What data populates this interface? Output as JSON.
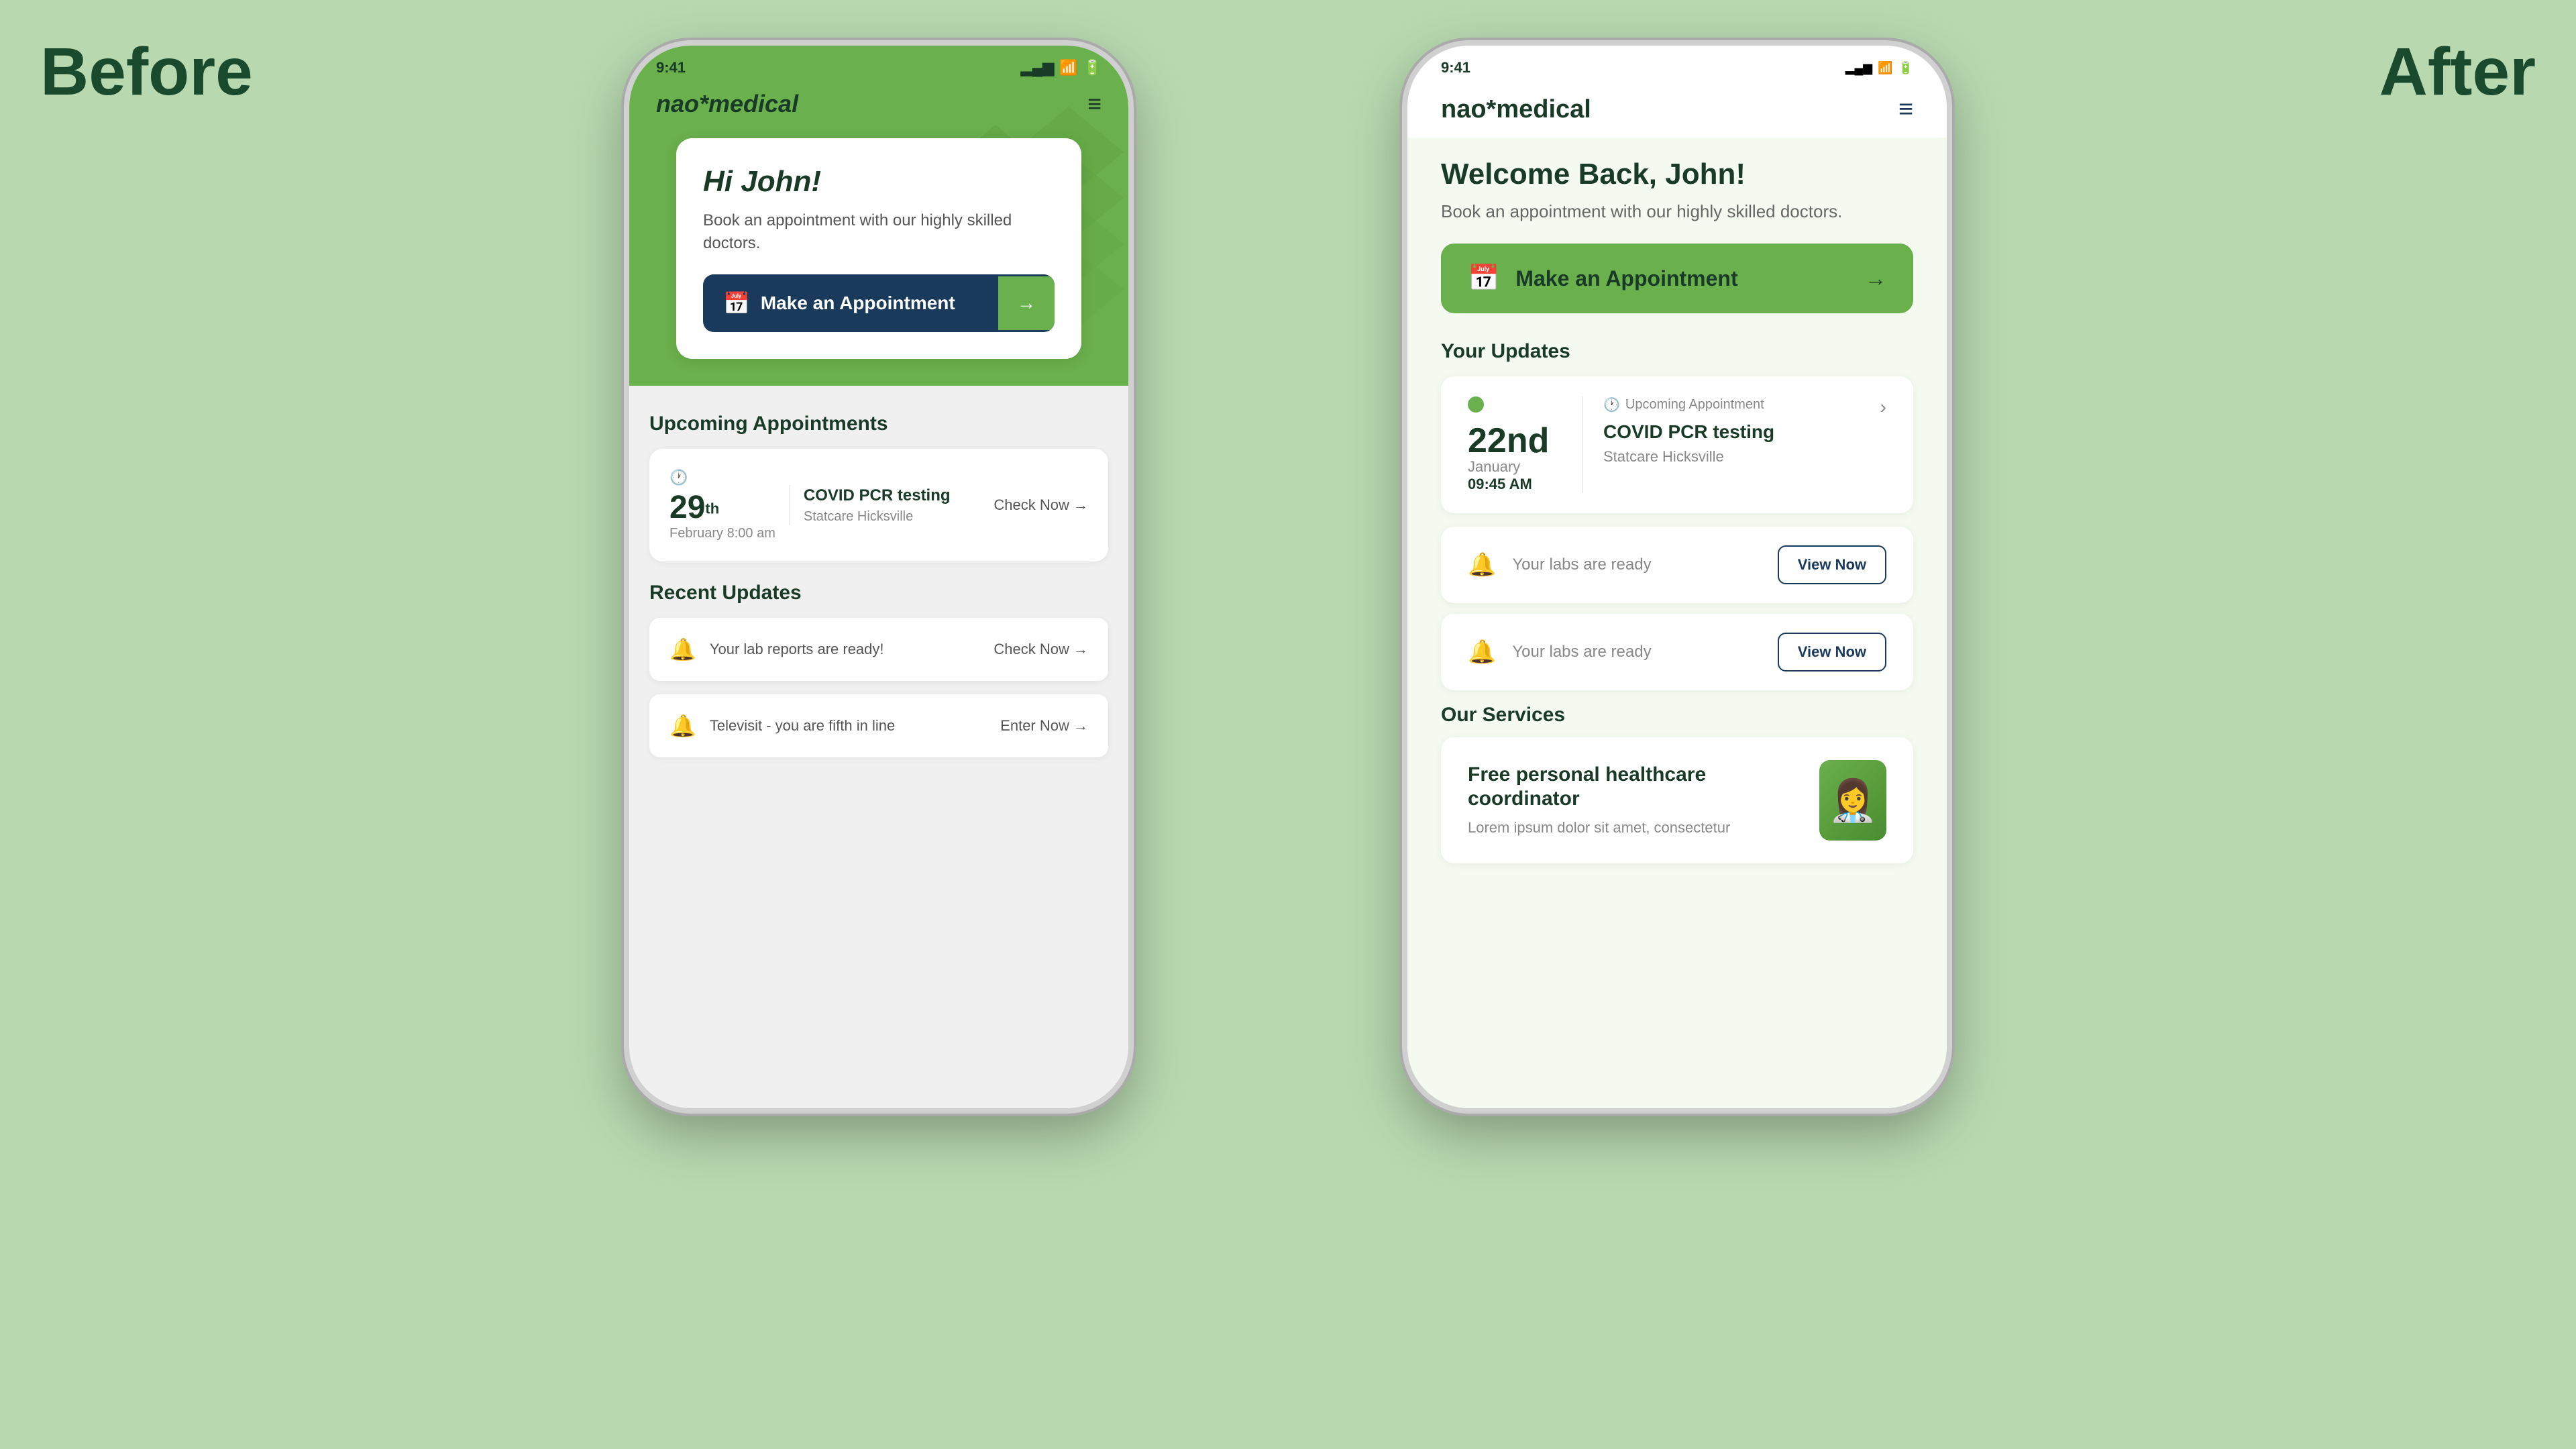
{
  "labels": {
    "before": "Before",
    "after": "After"
  },
  "before_phone": {
    "status": {
      "time": "9:41",
      "signal": "▂▄▆",
      "wifi": "WiFi",
      "battery": "🔋"
    },
    "nav": {
      "logo": "nao*medical",
      "menu": "≡"
    },
    "hero": {
      "greeting": "Hi John!",
      "subtitle": "Book an appointment with our highly skilled doctors.",
      "button": "Make an Appointment"
    },
    "upcoming": {
      "section_title": "Upcoming Appointments",
      "date_num": "29",
      "date_sup": "th",
      "date_label": "February",
      "time_label": "8:00 am",
      "appt_name": "COVID PCR testing",
      "appt_location": "Statcare Hicksville",
      "cta": "Check Now →"
    },
    "recent": {
      "section_title": "Recent Updates",
      "item1_text": "Your lab reports are ready!",
      "item1_cta": "Check Now →",
      "item2_text": "Televisit - you are fifth in line",
      "item2_cta": "Enter Now →"
    }
  },
  "after_phone": {
    "status": {
      "time": "9:41"
    },
    "nav": {
      "logo": "nao*medical",
      "menu": "≡"
    },
    "welcome": {
      "title": "Welcome Back, John!",
      "subtitle": "Book an appointment with our highly skilled doctors.",
      "button": "Make an Appointment"
    },
    "updates": {
      "section_title": "Your Updates",
      "upcoming_label": "Upcoming Appointment",
      "date_num": "22nd",
      "month": "January",
      "time": "09:45 AM",
      "appt_name": "COVID PCR testing",
      "appt_location": "Statcare Hicksville",
      "labs1": "Your labs are ready",
      "labs2": "Your labs are ready",
      "view_now": "View Now"
    },
    "services": {
      "section_title": "Our Services",
      "service_title": "Free personal healthcare coordinator",
      "service_sub": "Lorem ipsum dolor sit amet, consectetur"
    }
  }
}
